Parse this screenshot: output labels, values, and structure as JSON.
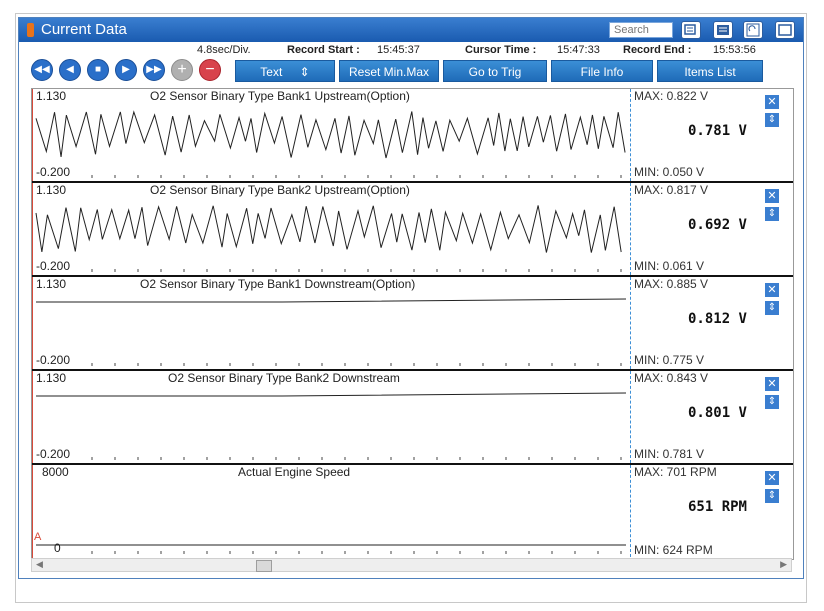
{
  "app": {
    "title": "Current Data",
    "search_placeholder": "Search"
  },
  "info": {
    "time_div": "4.8sec/Div.",
    "record_start_label": "Record Start :",
    "record_start": "15:45:37",
    "cursor_time_label": "Cursor Time :",
    "cursor_time": "15:47:33",
    "record_end_label": "Record End :",
    "record_end": "15:53:56"
  },
  "toolbar": {
    "text_label": "Text",
    "reset_label": "Reset Min.Max",
    "gototrig_label": "Go to Trig",
    "fileinfo_label": "File Info",
    "itemslist_label": "Items List"
  },
  "panels": [
    {
      "title": "O2 Sensor Binary Type Bank1 Upstream(Option)",
      "ymax": "1.130",
      "ymin": "-0.200",
      "max": "MAX: 0.822 V",
      "min": "MIN: 0.050 V",
      "value": "0.781 V"
    },
    {
      "title": "O2 Sensor Binary Type Bank2 Upstream(Option)",
      "ymax": "1.130",
      "ymin": "-0.200",
      "max": "MAX: 0.817 V",
      "min": "MIN: 0.061 V",
      "value": "0.692 V"
    },
    {
      "title": "O2 Sensor Binary Type Bank1 Downstream(Option)",
      "ymax": "1.130",
      "ymin": "-0.200",
      "max": "MAX: 0.885 V",
      "min": "MIN: 0.775 V",
      "value": "0.812 V"
    },
    {
      "title": "O2 Sensor Binary Type Bank2 Downstream",
      "ymax": "1.130",
      "ymin": "-0.200",
      "max": "MAX: 0.843 V",
      "min": "MIN: 0.781 V",
      "value": "0.801 V"
    },
    {
      "title": "Actual Engine Speed",
      "ymax": "8000",
      "ymin": "0",
      "max": "MAX:   701 RPM",
      "min": "MIN:   624 RPM",
      "value": "651 RPM"
    }
  ],
  "colors": {
    "titlebar": "#1a5bb0",
    "button": "#2a6fc9",
    "cursor": "#3d8fd6",
    "trig": "#d84a3a"
  },
  "icons": [
    "history-icon",
    "list-icon",
    "retry-icon",
    "window-icon",
    "rewind-icon",
    "prev-icon",
    "stop-icon",
    "play-icon",
    "forward-icon",
    "zoom-in-icon",
    "zoom-out-icon"
  ],
  "trig_marker": "A"
}
